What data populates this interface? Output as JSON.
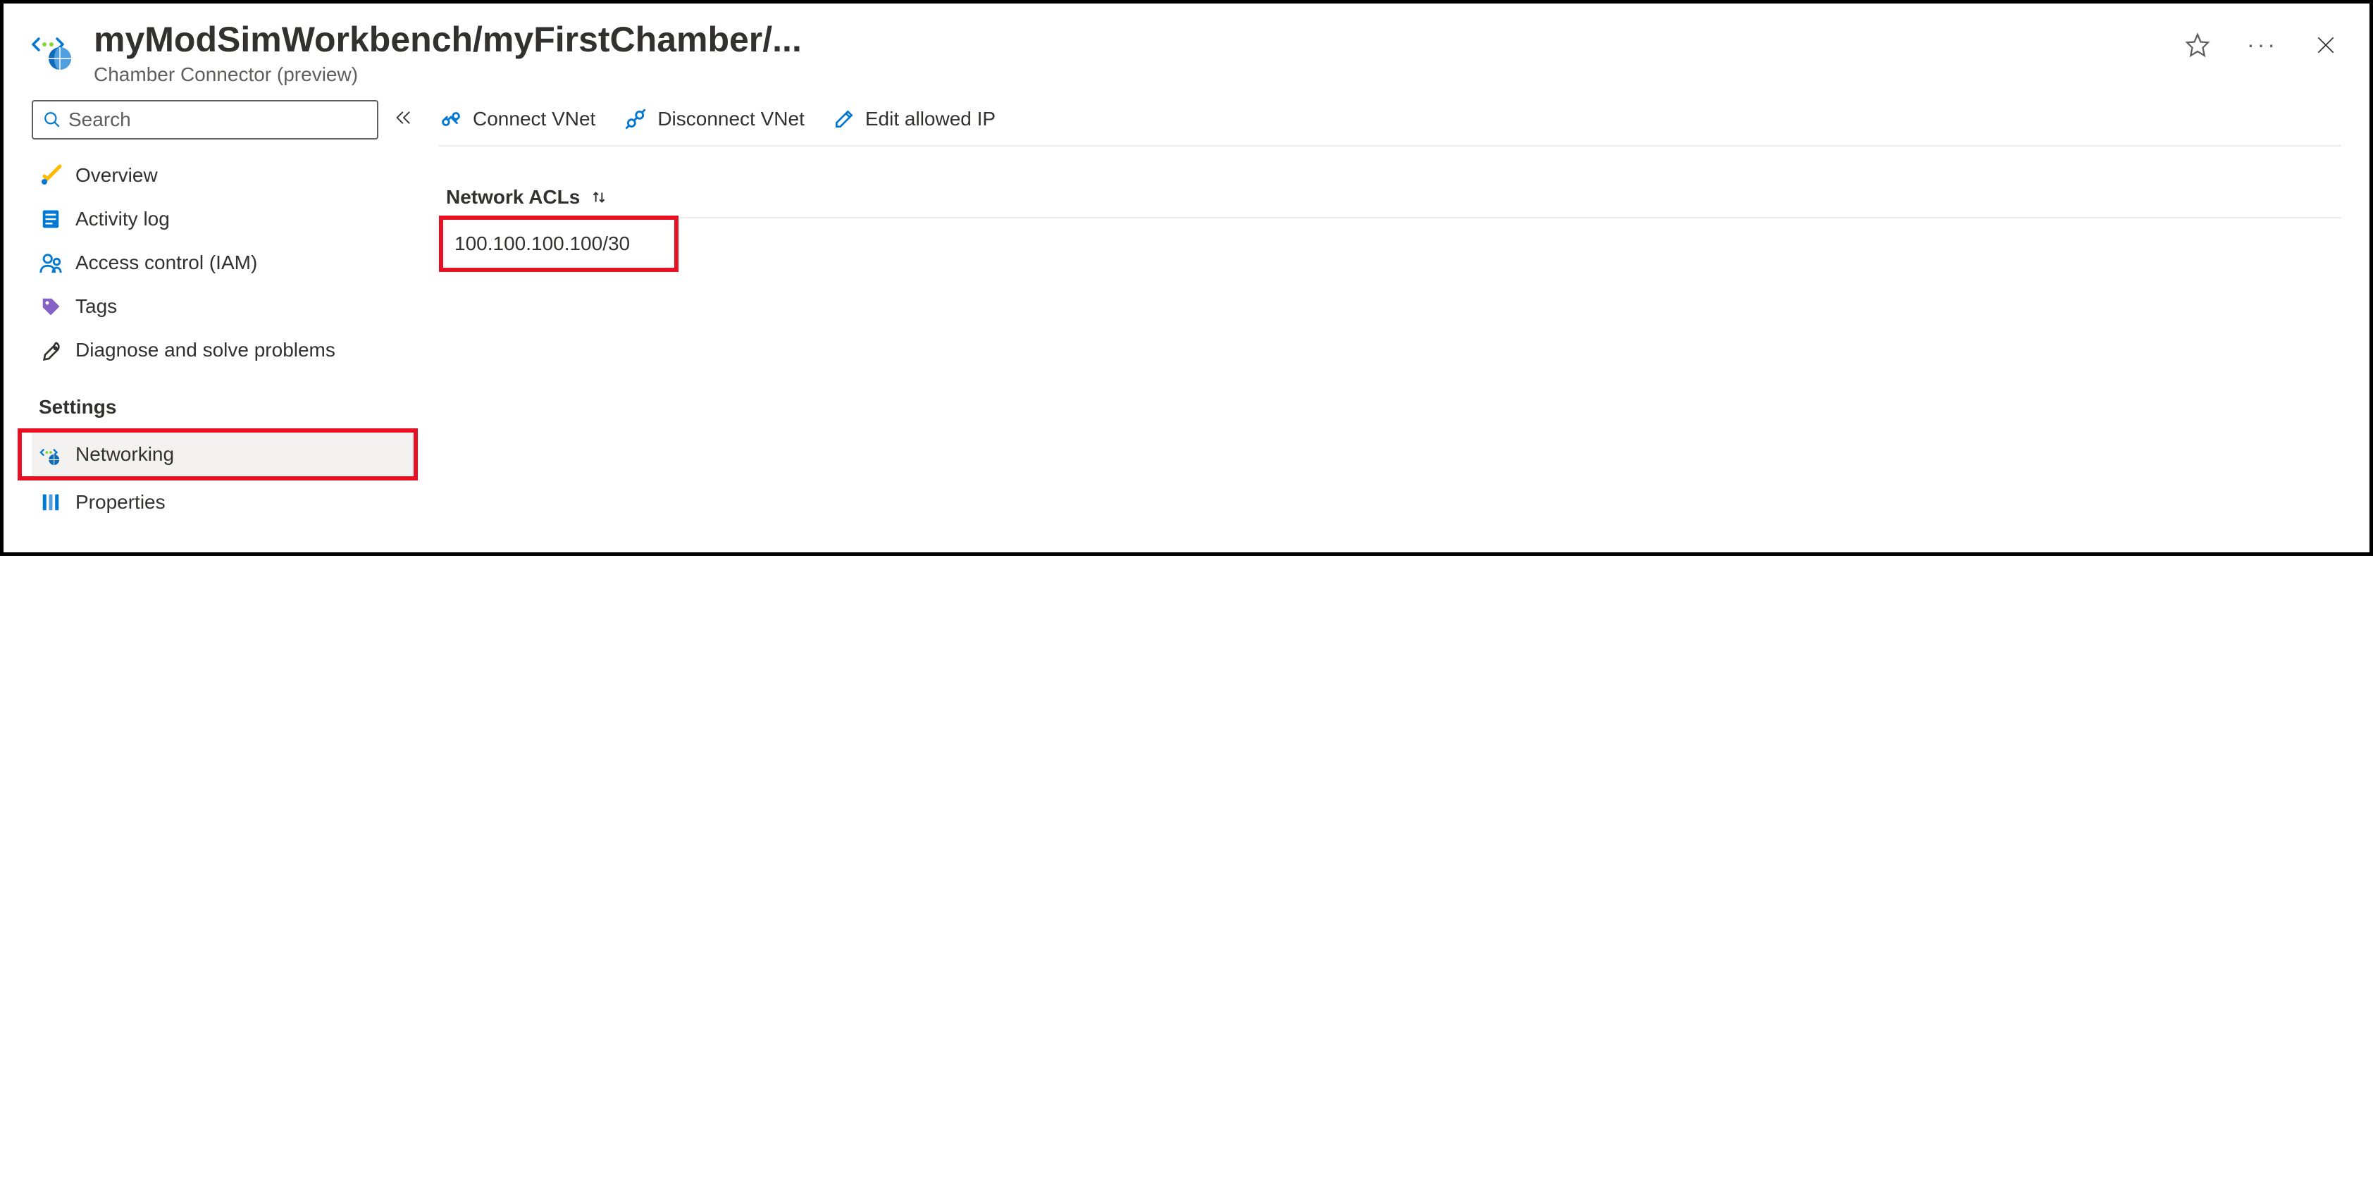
{
  "header": {
    "title": "myModSimWorkbench/myFirstChamber/...",
    "subtitle": "Chamber Connector (preview)"
  },
  "search": {
    "placeholder": "Search"
  },
  "sidebar": {
    "items": [
      {
        "label": "Overview"
      },
      {
        "label": "Activity log"
      },
      {
        "label": "Access control (IAM)"
      },
      {
        "label": "Tags"
      },
      {
        "label": "Diagnose and solve problems"
      }
    ],
    "settings_label": "Settings",
    "settings_items": [
      {
        "label": "Networking"
      },
      {
        "label": "Properties"
      }
    ]
  },
  "toolbar": {
    "connect_vnet": "Connect VNet",
    "disconnect_vnet": "Disconnect VNet",
    "edit_allowed_ip": "Edit allowed IP"
  },
  "table": {
    "column": "Network ACLs",
    "rows": [
      {
        "value": "100.100.100.100/30"
      }
    ]
  }
}
